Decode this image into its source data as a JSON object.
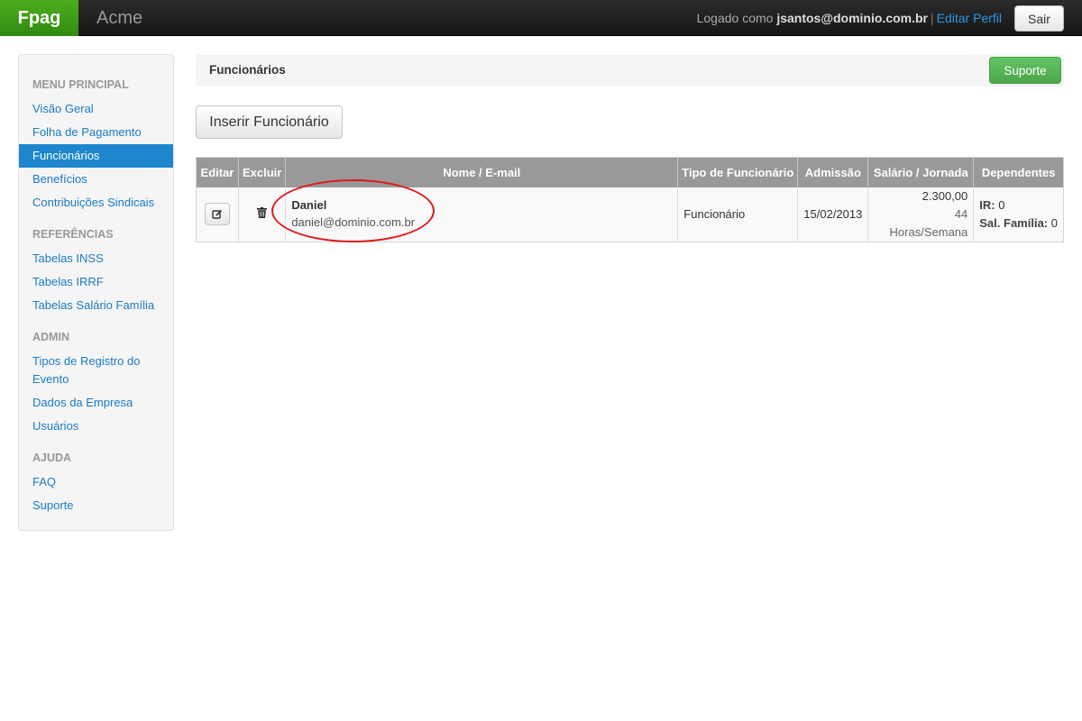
{
  "topbar": {
    "brand": "Fpag",
    "company": "Acme",
    "logged_as_label": "Logado como",
    "user_email": "jsantos@dominio.com.br",
    "separator": "|",
    "edit_profile": "Editar Perfil",
    "logout": "Sair"
  },
  "sidebar": {
    "groups": [
      {
        "header": "MENU PRINCIPAL",
        "items": [
          "Visão Geral",
          "Folha de Pagamento",
          "Funcionários",
          "Benefícios",
          "Contribuições Sindicais"
        ]
      },
      {
        "header": "REFERÊNCIAS",
        "items": [
          "Tabelas INSS",
          "Tabelas IRRF",
          "Tabelas Salário Família"
        ]
      },
      {
        "header": "ADMIN",
        "items": [
          "Tipos de Registro do Evento",
          "Dados da Empresa",
          "Usuários"
        ]
      },
      {
        "header": "AJUDA",
        "items": [
          "FAQ",
          "Suporte"
        ]
      }
    ],
    "active_item": "Funcionários"
  },
  "main": {
    "title": "Funcionários",
    "support_button": "Suporte",
    "insert_button": "Inserir Funcionário",
    "table": {
      "headers": [
        "Editar",
        "Excluir",
        "Nome / E-mail",
        "Tipo de Funcionário",
        "Admissão",
        "Salário / Jornada",
        "Dependentes"
      ],
      "rows": [
        {
          "name": "Daniel",
          "email": "daniel@dominio.com.br",
          "type": "Funcionário",
          "admission": "15/02/2013",
          "salary": "2.300,00",
          "hours": "44 Horas/Semana",
          "ir_label": "IR:",
          "ir_value": "0",
          "sf_label": "Sal. Família:",
          "sf_value": "0"
        }
      ]
    }
  },
  "colors": {
    "brand_green": "#3a9b16",
    "link_blue": "#1a7bc6",
    "active_blue": "#1d86cf",
    "annotation_red": "#e01919"
  }
}
